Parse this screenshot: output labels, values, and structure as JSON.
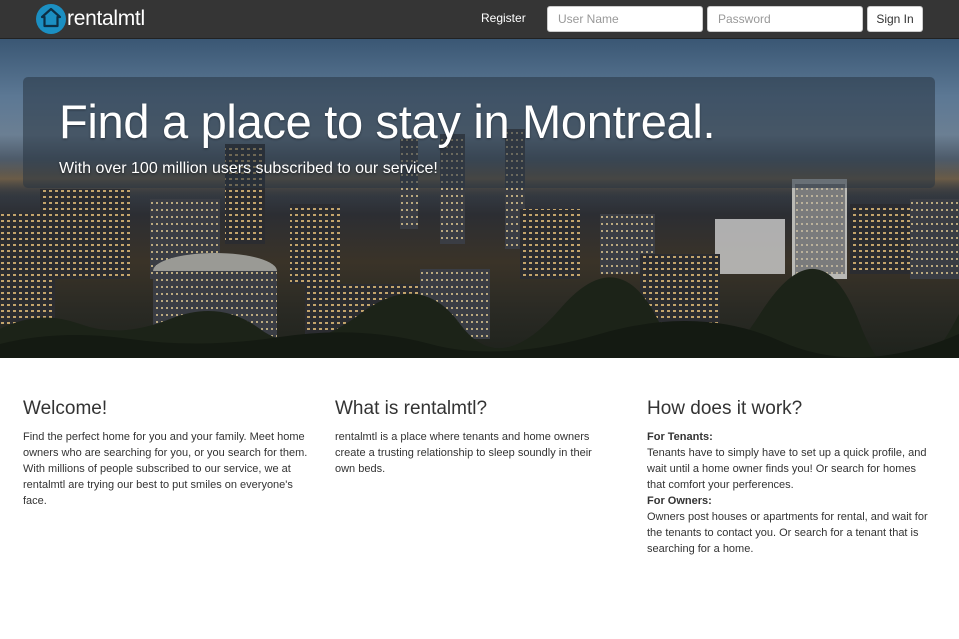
{
  "navbar": {
    "brand": "rentalmtl",
    "register_label": "Register",
    "username_placeholder": "User Name",
    "password_placeholder": "Password",
    "signin_label": "Sign In"
  },
  "hero": {
    "title": "Find a place to stay in Montreal.",
    "subtitle": "With over 100 million users subscribed to our service!"
  },
  "columns": {
    "welcome": {
      "heading": "Welcome!",
      "body": "Find the perfect home for you and your family. Meet home owners who are searching for you, or you search for them. With millions of people subscribed to our service, we at rentalmtl are trying our best to put smiles on everyone's face."
    },
    "what": {
      "heading": "What is rentalmtl?",
      "body": "rentalmtl is a place where tenants and home owners create a trusting relationship to sleep soundly in their own beds."
    },
    "how": {
      "heading": "How does it work?",
      "tenants_label": "For Tenants:",
      "tenants_body": "Tenants have to simply have to set up a quick profile, and wait until a home owner finds you! Or search for homes that comfort your perferences.",
      "owners_label": "For Owners:",
      "owners_body": "Owners post houses or apartments for rental, and wait for the tenants to contact you. Or search for a tenant that is searching for a home."
    }
  },
  "colors": {
    "navbar_bg": "#353535",
    "brand_icon": "#1b8fc2"
  },
  "icons": {
    "brand_logo": "house-icon"
  }
}
